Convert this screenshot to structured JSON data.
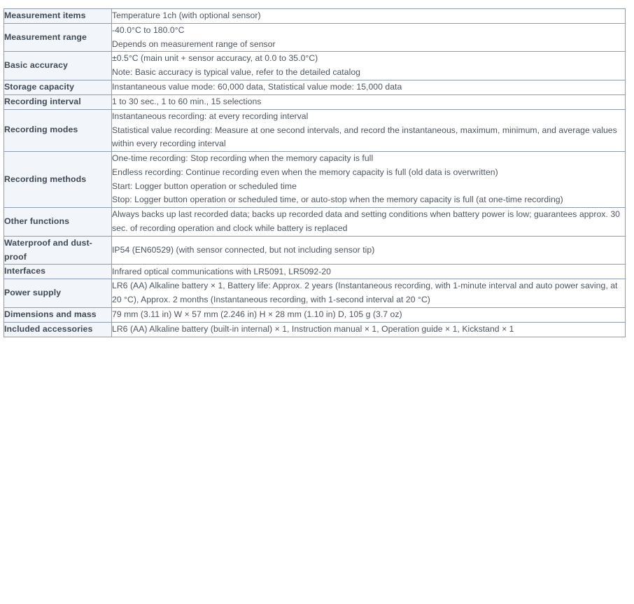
{
  "table": {
    "colors": {
      "border": "#8d9cb0",
      "label_background": "#f2f5f9",
      "value_background": "#ffffff",
      "label_text": "#3f4a56",
      "value_text": "#4c5560"
    },
    "rows": [
      {
        "label": "Measurement items",
        "lines": [
          "Temperature 1ch (with optional sensor)"
        ]
      },
      {
        "label": "Measurement range",
        "lines": [
          "-40.0°C to 180.0°C",
          "Depends on measurement range of sensor"
        ]
      },
      {
        "label": "Basic accuracy",
        "lines": [
          "±0.5°C (main unit + sensor accuracy, at 0.0 to 35.0°C)",
          "Note: Basic accuracy is typical value, refer to the detailed catalog"
        ]
      },
      {
        "label": "Storage capacity",
        "lines": [
          "Instantaneous value mode: 60,000 data, Statistical value mode: 15,000 data"
        ]
      },
      {
        "label": "Recording interval",
        "lines": [
          "1 to 30 sec., 1 to 60 min., 15 selections"
        ]
      },
      {
        "label": "Recording modes",
        "lines": [
          "Instantaneous recording: at every recording interval",
          "Statistical value recording: Measure at one second intervals, and record the instantaneous, maximum, minimum, and average values within every recording interval"
        ]
      },
      {
        "label": "Recording methods",
        "lines": [
          "One-time recording: Stop recording when the memory capacity is full",
          "Endless recording: Continue recording even when the memory capacity is full (old data is overwritten)",
          "Start: Logger button operation or scheduled time",
          "Stop: Logger button operation or scheduled time, or auto-stop when the memory capacity is full (at one-time recording)"
        ]
      },
      {
        "label": "Other functions",
        "lines": [
          "Always backs up last recorded data; backs up recorded data and setting conditions when battery power is low; guarantees approx. 30 sec. of recording operation and clock while battery is replaced"
        ]
      },
      {
        "label": "Waterproof and dust-proof",
        "lines": [
          "IP54 (EN60529) (with sensor connected, but not including sensor tip)"
        ]
      },
      {
        "label": "Interfaces",
        "lines": [
          "Infrared optical communications with LR5091, LR5092-20"
        ]
      },
      {
        "label": "Power supply",
        "lines": [
          "LR6 (AA) Alkaline battery × 1, Battery life: Approx. 2 years (Instantaneous recording, with 1-minute interval and auto power saving, at 20 °C), Approx. 2 months (Instantaneous recording, with 1-second interval at 20 °C)"
        ]
      },
      {
        "label": "Dimensions and mass",
        "lines": [
          "79 mm (3.11 in) W × 57 mm (2.246 in) H × 28 mm (1.10 in) D, 105 g (3.7 oz)"
        ]
      },
      {
        "label": "Included accessories",
        "lines": [
          "LR6 (AA) Alkaline battery (built-in internal) × 1, Instruction manual × 1, Operation guide × 1, Kickstand × 1"
        ]
      }
    ]
  }
}
